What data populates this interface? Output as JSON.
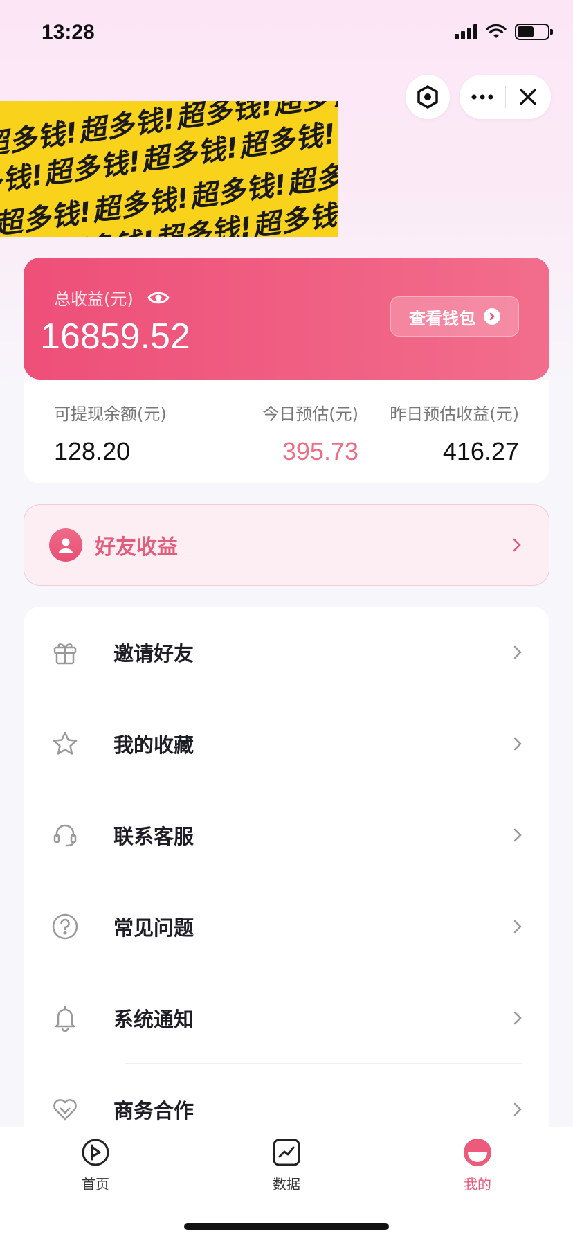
{
  "status_bar": {
    "time": "13:28"
  },
  "banner": {
    "pattern_text": "超多钱!超多钱!超多钱!超多钱!超多钱!超多钱!",
    "bg_color": "#f9d31b"
  },
  "earnings": {
    "label": "总收益(元)",
    "total": "16859.52",
    "wallet_button": "查看钱包",
    "accent_color": "#ee4f78"
  },
  "stats": [
    {
      "label": "可提现余额(元)",
      "value": "128.20"
    },
    {
      "label": "今日预估(元)",
      "value": "395.73"
    },
    {
      "label": "昨日预估收益(元)",
      "value": "416.27"
    }
  ],
  "friend_earnings": {
    "label": "好友收益"
  },
  "menu": [
    {
      "label": "邀请好友",
      "icon": "gift-icon"
    },
    {
      "label": "我的收藏",
      "icon": "star-icon"
    },
    {
      "label": "联系客服",
      "icon": "headset-icon"
    },
    {
      "label": "常见问题",
      "icon": "question-icon"
    },
    {
      "label": "系统通知",
      "icon": "bell-icon"
    },
    {
      "label": "商务合作",
      "icon": "heart-icon"
    }
  ],
  "tabbar": [
    {
      "label": "首页",
      "icon": "home-play-icon",
      "active": false
    },
    {
      "label": "数据",
      "icon": "chart-icon",
      "active": false
    },
    {
      "label": "我的",
      "icon": "profile-icon",
      "active": true
    }
  ]
}
